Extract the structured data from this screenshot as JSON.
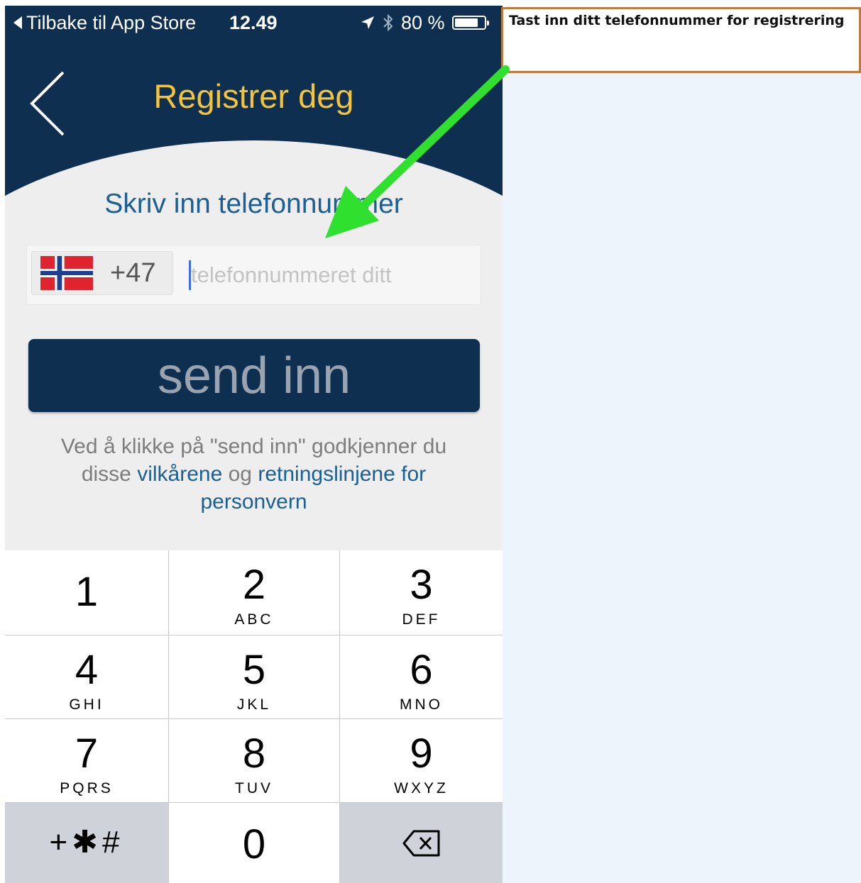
{
  "status_bar": {
    "back_to_store": "Tilbake til App Store",
    "time": "12.49",
    "battery_text": "80 %",
    "battery_level": 0.8
  },
  "nav": {
    "title": "Registrer deg",
    "back_icon": "chevron-left-icon"
  },
  "form": {
    "instruction": "Skriv inn telefonnummer",
    "country_code": "+47",
    "country_flag": "norway-flag-icon",
    "phone_placeholder": "telefonnummeret ditt",
    "phone_value": "",
    "submit_label": "send inn"
  },
  "consent": {
    "line_prefix": "Ved å klikke på \"send inn\" godkjenner du disse",
    "terms_link": "vilkårene",
    "conjunction": "og",
    "privacy_link": "retningslinjene for personvern"
  },
  "keypad": {
    "keys": [
      {
        "digit": "1",
        "letters": ""
      },
      {
        "digit": "2",
        "letters": "ABC"
      },
      {
        "digit": "3",
        "letters": "DEF"
      },
      {
        "digit": "4",
        "letters": "GHI"
      },
      {
        "digit": "5",
        "letters": "JKL"
      },
      {
        "digit": "6",
        "letters": "MNO"
      },
      {
        "digit": "7",
        "letters": "PQRS"
      },
      {
        "digit": "8",
        "letters": "TUV"
      },
      {
        "digit": "9",
        "letters": "WXYZ"
      }
    ],
    "special_label": "+✱#",
    "zero": "0",
    "delete_icon": "backspace-icon"
  },
  "annotation": {
    "text": "Tast inn ditt telefonnummer for registrering",
    "arrow_color": "#2fe02f",
    "border_color": "#c07a3a"
  },
  "colors": {
    "navy": "#0e2f4f",
    "title_gold": "#f3c33c",
    "link_blue": "#1c5f92"
  }
}
